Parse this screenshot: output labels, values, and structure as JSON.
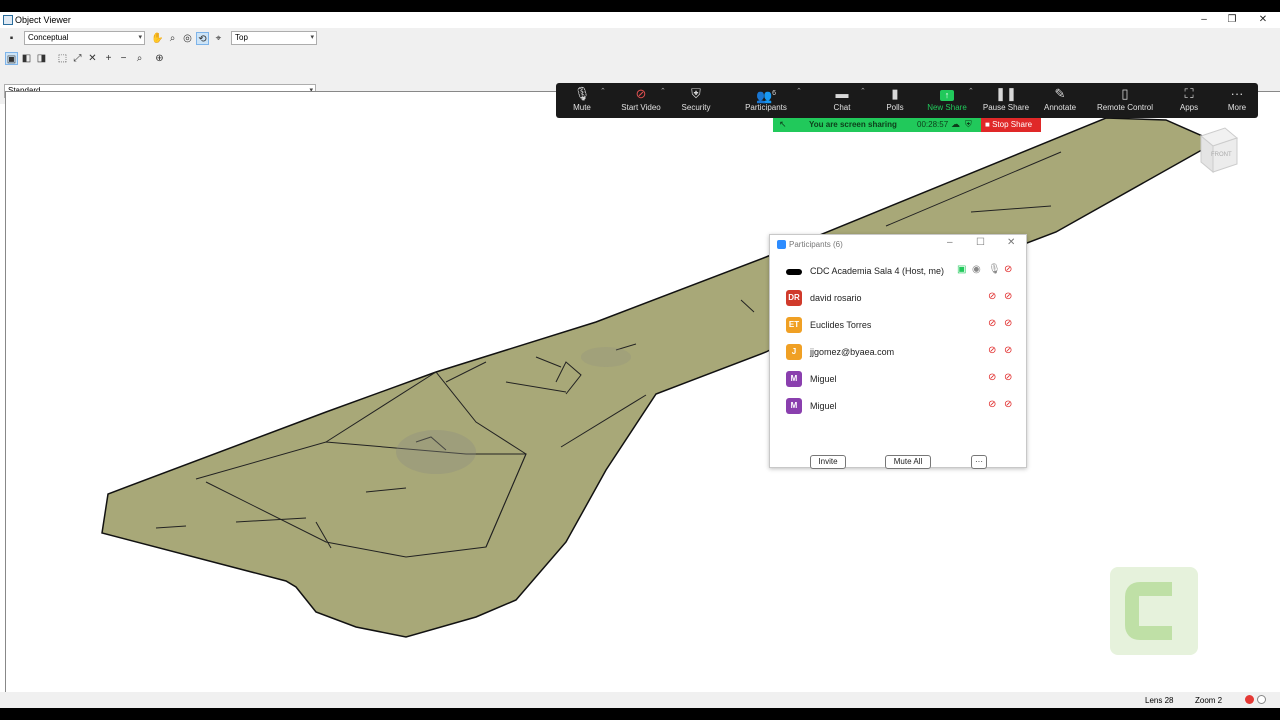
{
  "window": {
    "title": "Object Viewer"
  },
  "toolbar": {
    "visual_style": "Conceptual",
    "view": "Top",
    "style": "Standard"
  },
  "zoom_toolbar": {
    "buttons": [
      {
        "label": "Mute",
        "icon": "microphone-icon"
      },
      {
        "label": "Start Video",
        "icon": "video-off-icon"
      },
      {
        "label": "Security",
        "icon": "shield-icon"
      },
      {
        "label": "Participants",
        "icon": "people-icon",
        "count": "6"
      },
      {
        "label": "Chat",
        "icon": "chat-icon"
      },
      {
        "label": "Polls",
        "icon": "polls-icon"
      },
      {
        "label": "New Share",
        "icon": "share-icon"
      },
      {
        "label": "Pause Share",
        "icon": "pause-icon"
      },
      {
        "label": "Annotate",
        "icon": "pen-icon"
      },
      {
        "label": "Remote Control",
        "icon": "mouse-icon"
      },
      {
        "label": "Apps",
        "icon": "apps-icon"
      },
      {
        "label": "More",
        "icon": "more-icon"
      }
    ]
  },
  "share_banner": {
    "text": "You are screen sharing",
    "timer": "00:28:57",
    "stop_label": "Stop Share"
  },
  "nav_cube": {
    "face_label": "FRONT"
  },
  "participants_panel": {
    "title": "Participants (6)",
    "participants": [
      {
        "initials": "",
        "name": "CDC Academia Sala 4 (Host, me)",
        "color": "#000000"
      },
      {
        "initials": "DR",
        "name": "david rosario",
        "color": "#d03a2b"
      },
      {
        "initials": "ET",
        "name": "Euclides Torres",
        "color": "#f0a024"
      },
      {
        "initials": "J",
        "name": "jjgomez@byaea.com",
        "color": "#f0a024"
      },
      {
        "initials": "M",
        "name": "Miguel",
        "color": "#8a3fae"
      },
      {
        "initials": "M",
        "name": "Miguel",
        "color": "#8a3fae"
      }
    ],
    "invite_label": "Invite",
    "mute_all_label": "Mute All",
    "more_label": "···"
  },
  "status": {
    "lens": "Lens 28",
    "zoom": "Zoom 2"
  },
  "colors": {
    "terrain": "#a8a878",
    "zoom_bg": "#1a1a1a",
    "share_green": "#21c95b",
    "stop_red": "#e02828"
  }
}
